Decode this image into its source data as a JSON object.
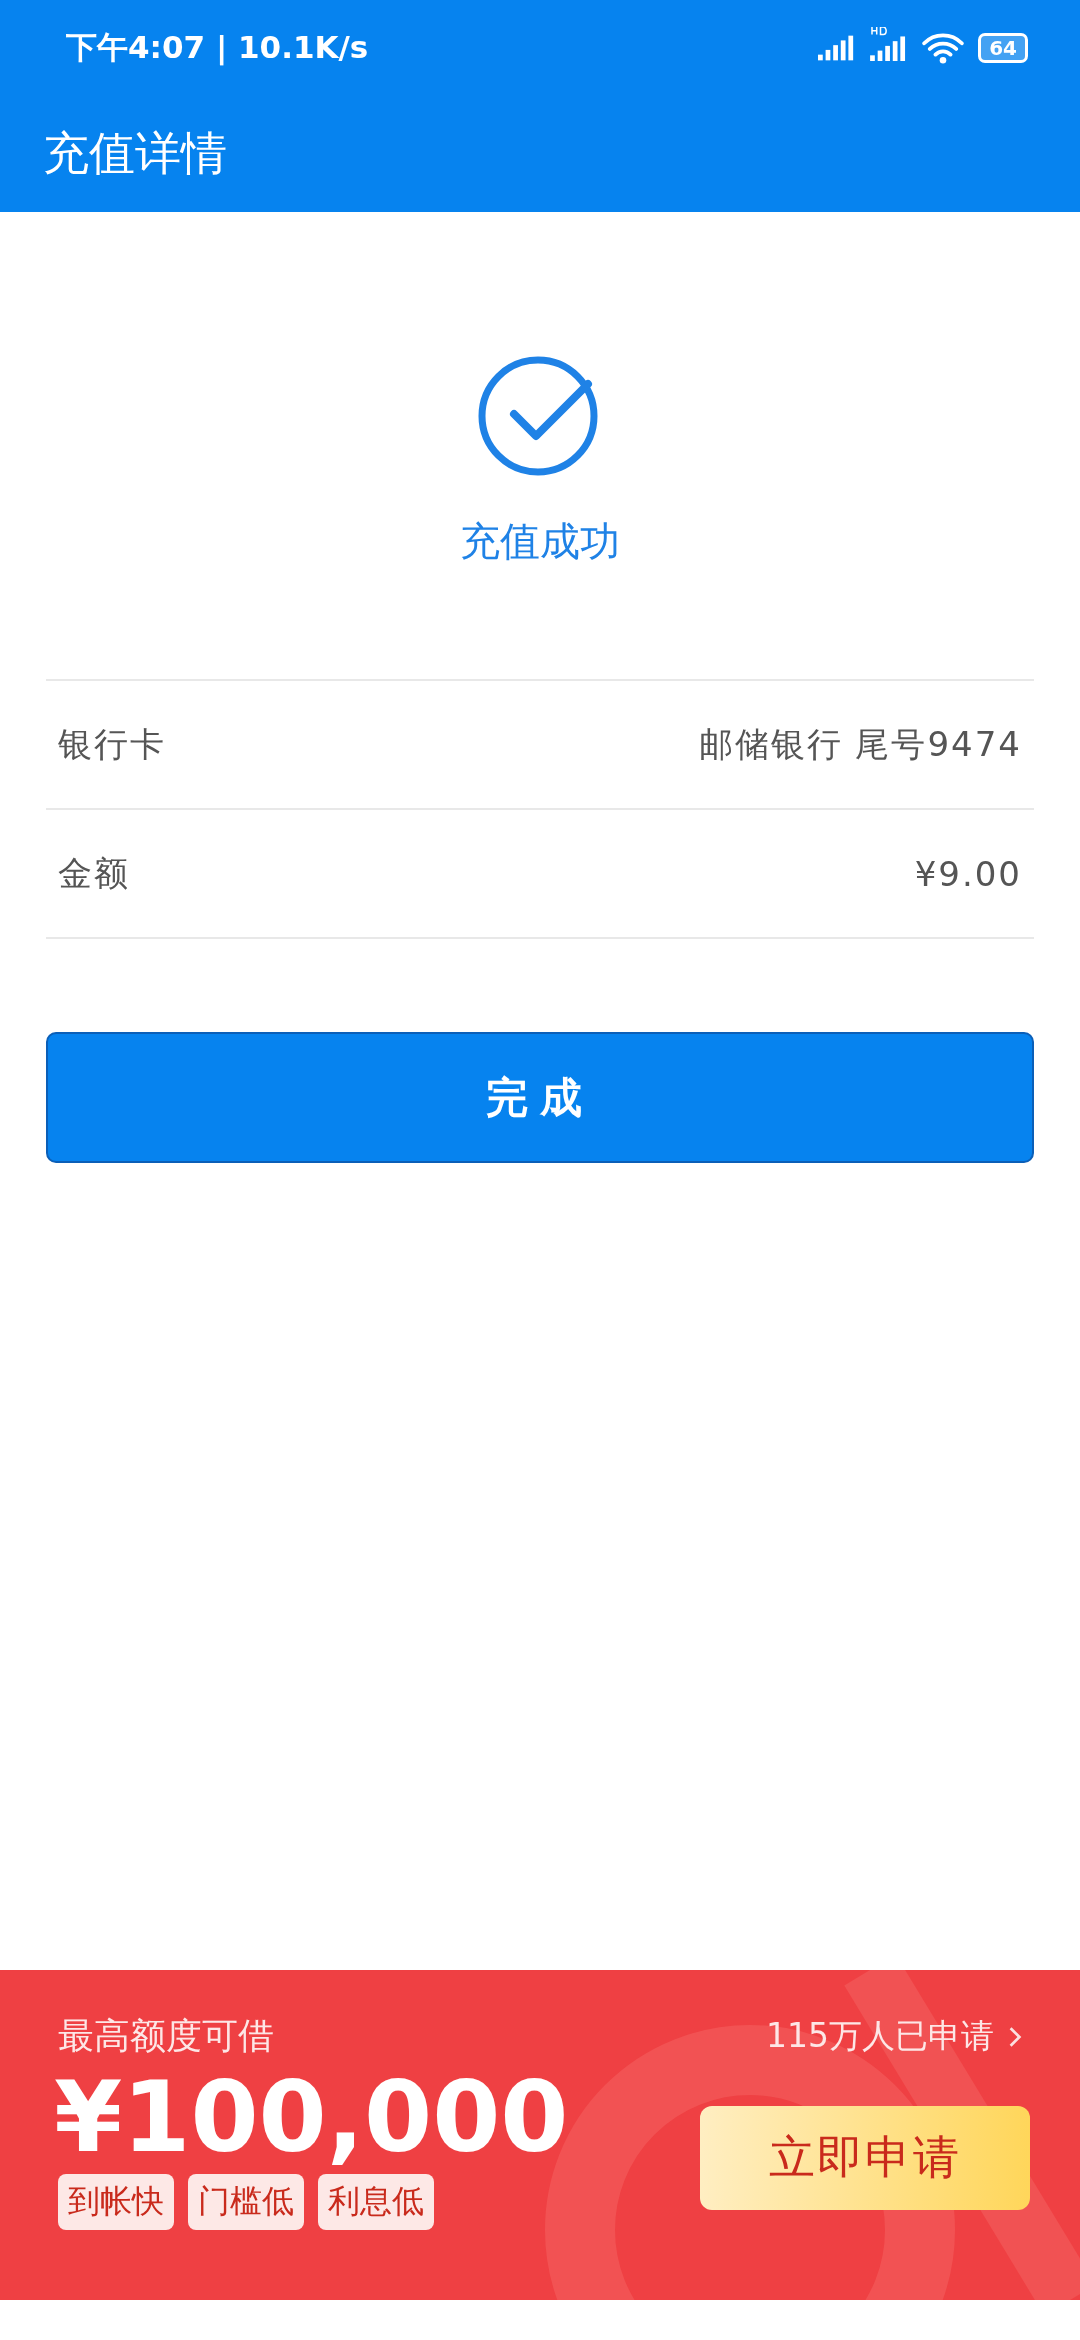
{
  "status_bar": {
    "time": "下午4:07 | 10.1K/s",
    "battery": "64"
  },
  "header": {
    "title": "充值详情"
  },
  "result": {
    "message": "充值成功"
  },
  "details": [
    {
      "label": "银行卡",
      "value": "邮储银行 尾号9474"
    },
    {
      "label": "金额",
      "value": "¥9.00"
    }
  ],
  "done_button": "完成",
  "loan_banner": {
    "headline": "最高额度可借",
    "applicants": "115万人已申请",
    "amount": "¥100,000",
    "tags": [
      "到帐快",
      "门槛低",
      "利息低"
    ],
    "apply_button": "立即申请"
  }
}
